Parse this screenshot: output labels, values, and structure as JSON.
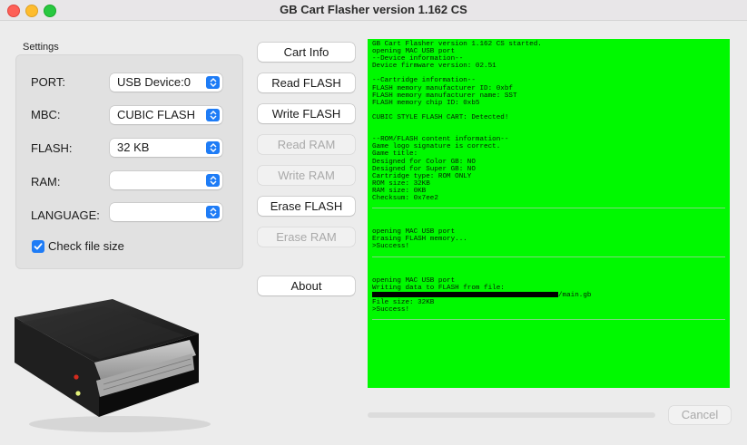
{
  "window": {
    "title": "GB Cart Flasher version 1.162 CS"
  },
  "settings": {
    "group_label": "Settings",
    "rows": [
      {
        "label": "PORT:",
        "value": "USB Device:0"
      },
      {
        "label": "MBC:",
        "value": "CUBIC FLASH"
      },
      {
        "label": "FLASH:",
        "value": "32 KB"
      },
      {
        "label": "RAM:",
        "value": ""
      },
      {
        "label": "LANGUAGE:",
        "value": ""
      }
    ],
    "check_file_size": {
      "label": "Check file size",
      "checked": true
    }
  },
  "buttons": {
    "cart_info": "Cart Info",
    "read_flash": "Read FLASH",
    "write_flash": "Write FLASH",
    "read_ram": "Read RAM",
    "write_ram": "Write RAM",
    "erase_flash": "Erase FLASH",
    "erase_ram": "Erase RAM",
    "about": "About",
    "cancel": "Cancel"
  },
  "console": {
    "block1": [
      "GB Cart Flasher version 1.162 CS started.",
      "opening MAC USB port",
      "--Device information--",
      "Device firmware version: 02.51",
      "",
      "--Cartridge information--",
      "FLASH memory manufacturer ID: 0xbf",
      "FLASH memory manufacturer name: SST",
      "FLASH memory chip ID: 0xb5",
      "",
      "CUBIC STYLE FLASH CART: Detected!",
      "",
      "",
      "--ROM/FLASH content information--",
      "Game logo signature is correct.",
      "Game title:",
      "Designed for Color GB: NO",
      "Designed for Super GB: NO",
      "Cartridge type: ROM ONLY",
      "ROM size: 32KB",
      "RAM size: 0KB",
      "Checksum: 0x7ee2"
    ],
    "block2": [
      "opening MAC USB port",
      "Erasing FLASH memory...",
      ">Success!"
    ],
    "block3_pre": [
      "opening MAC USB port",
      "Writing data to FLASH from file:"
    ],
    "file_path_suffix": "/main.gb",
    "block3_post": [
      "File size: 32KB",
      ">Success!"
    ]
  },
  "progress": {
    "fraction": 0
  },
  "colors": {
    "console_bg": "#00f900",
    "accent": "#1e7cf6"
  }
}
